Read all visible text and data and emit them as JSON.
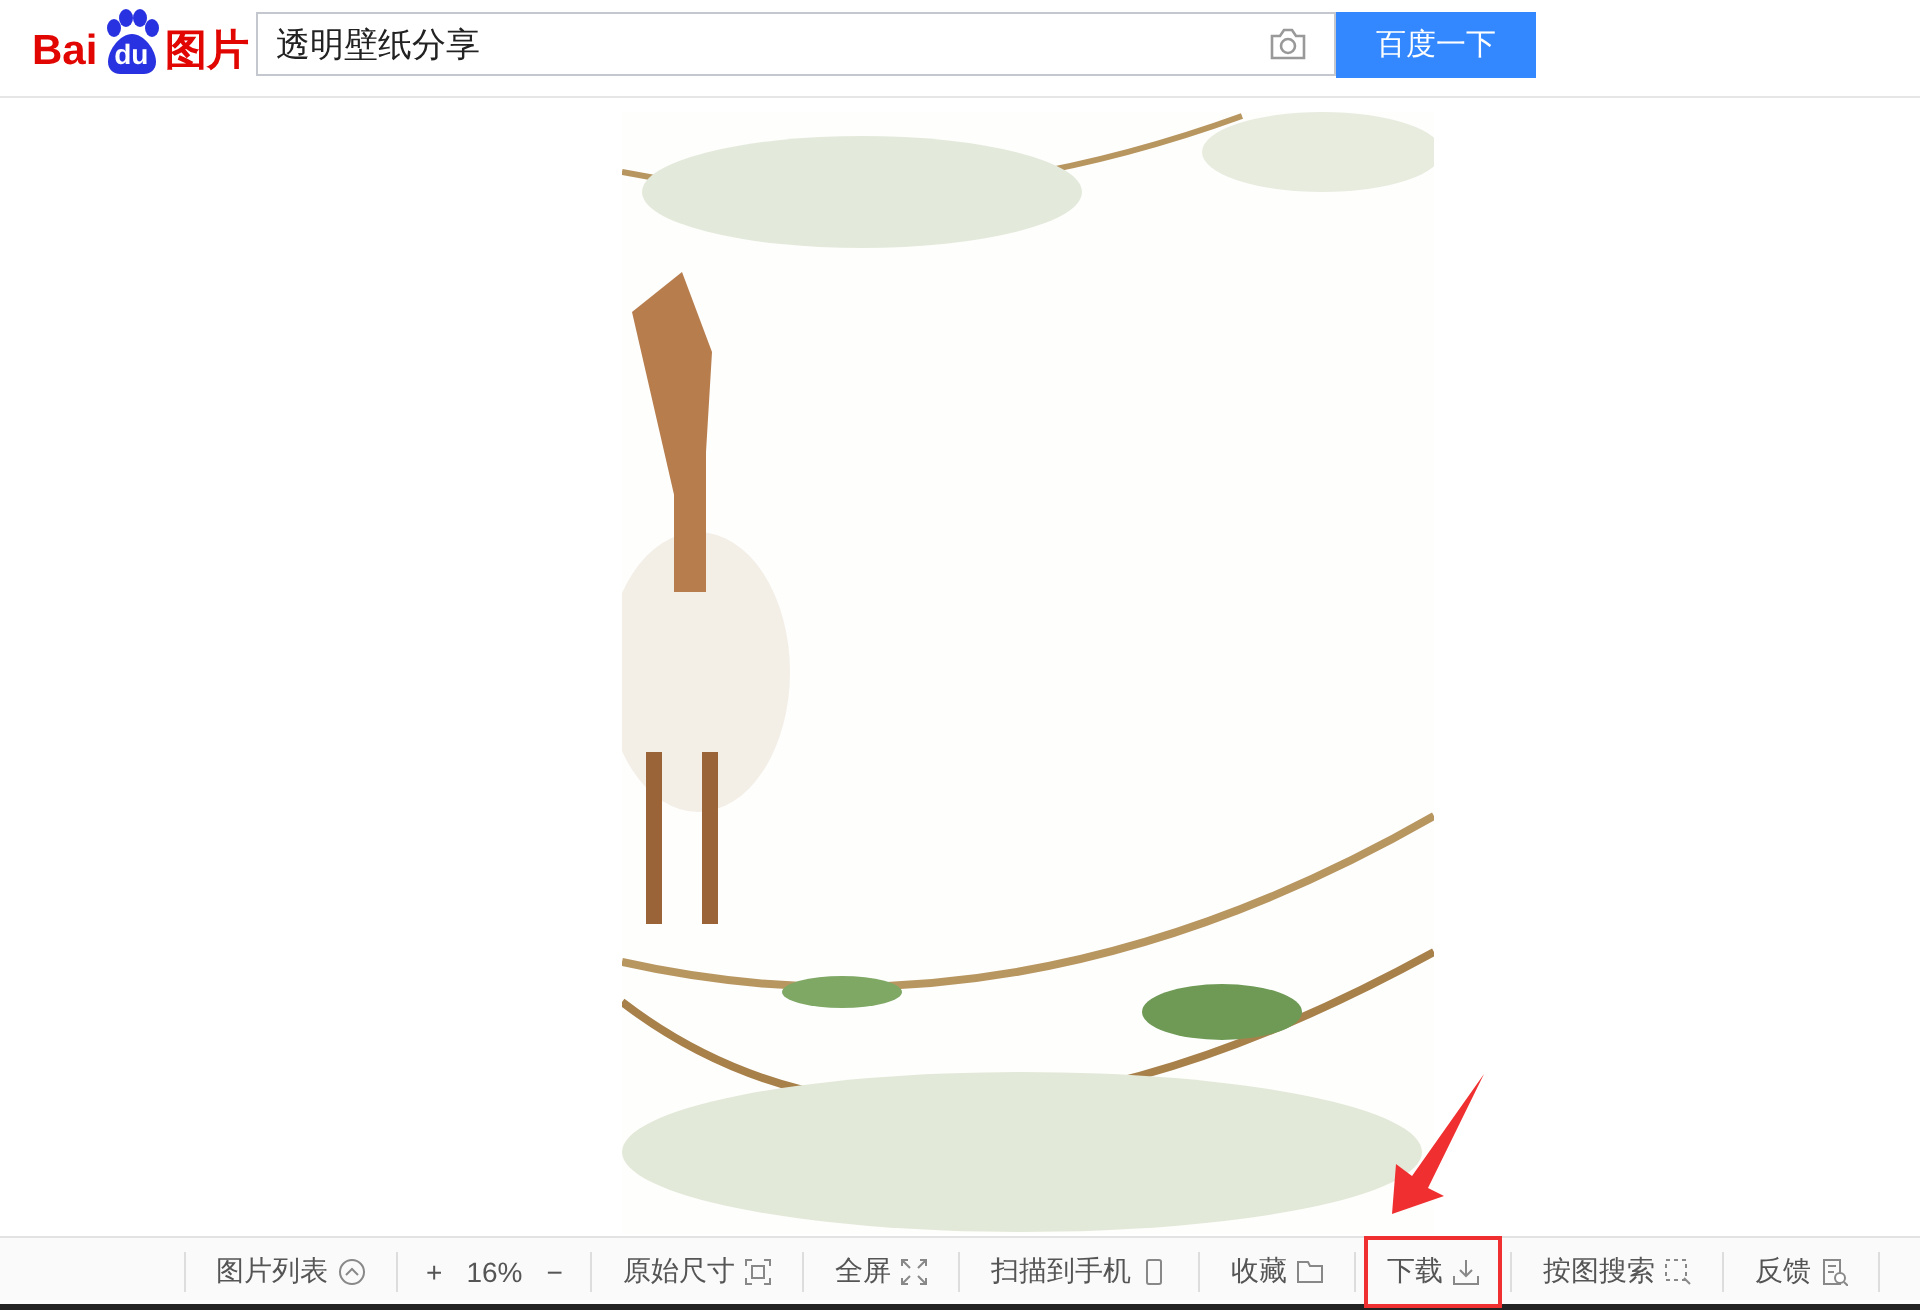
{
  "logo": {
    "part_1": "Bai",
    "part_2": "du",
    "part_3": "图片"
  },
  "search": {
    "value": "透明壁纸分享",
    "button": "百度一下"
  },
  "toolbar": [
    {
      "kind": "text",
      "label": "图片列表",
      "highlighted": false
    },
    {
      "kind": "zoom",
      "plus": "+",
      "reading": "16%",
      "minus": "−"
    },
    {
      "kind": "text",
      "label": "原始尺寸",
      "highlighted": false
    },
    {
      "kind": "text",
      "label": "全屏",
      "highlighted": false
    },
    {
      "kind": "text",
      "label": "扫描到手机",
      "highlighted": false
    },
    {
      "kind": "text",
      "label": "收藏",
      "highlighted": false
    },
    {
      "kind": "text",
      "label": "下载",
      "highlighted": true
    },
    {
      "kind": "text",
      "label": "按图搜索",
      "highlighted": false
    },
    {
      "kind": "text",
      "label": "反馈",
      "highlighted": false
    }
  ]
}
